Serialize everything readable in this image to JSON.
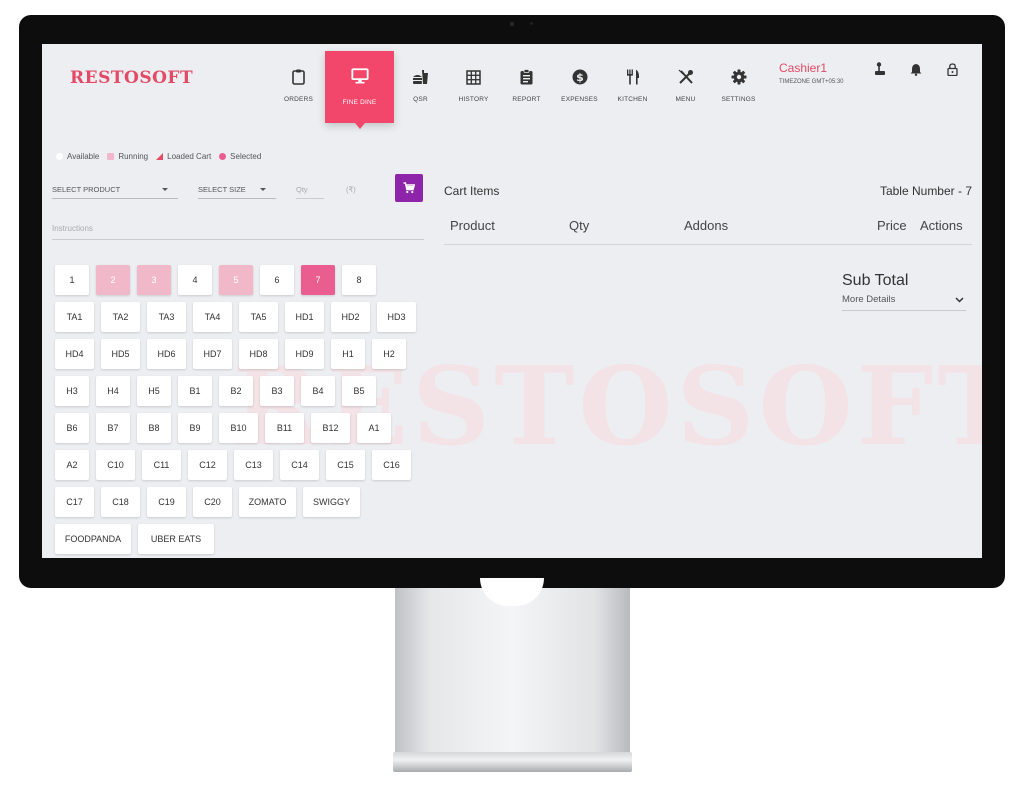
{
  "app": {
    "logo": "RESTOSOFT",
    "watermark": "RESTOSOFT",
    "accent": "#f2466b"
  },
  "nav": [
    {
      "label": "ORDERS",
      "icon": "clipboard-icon",
      "active": false
    },
    {
      "label": "FINE DINE",
      "icon": "monitor-icon",
      "active": true
    },
    {
      "label": "QSR",
      "icon": "fastfood-icon",
      "active": false
    },
    {
      "label": "HISTORY",
      "icon": "grid-icon",
      "active": false
    },
    {
      "label": "REPORT",
      "icon": "report-icon",
      "active": false
    },
    {
      "label": "EXPENSES",
      "icon": "dollar-icon",
      "active": false
    },
    {
      "label": "KITCHEN",
      "icon": "cutlery-icon",
      "active": false
    },
    {
      "label": "MENU",
      "icon": "crossed-utensils-icon",
      "active": false
    },
    {
      "label": "SETTINGS",
      "icon": "gear-icon",
      "active": false
    }
  ],
  "user": {
    "name": "Cashier1",
    "timezone": "TIMEZONE GMT+05:30"
  },
  "legend": [
    {
      "label": "Available",
      "color": "#ffffff"
    },
    {
      "label": "Running",
      "color": "#f0b8c8"
    },
    {
      "label": "Loaded Cart",
      "color": "#e24a66"
    },
    {
      "label": "Selected",
      "color": "#ea5e8f"
    }
  ],
  "form": {
    "select_product": "SELECT PRODUCT",
    "select_size": "SELECT SIZE",
    "qty_placeholder": "Qty",
    "price_placeholder": "(₹)",
    "instructions_placeholder": "Instructions"
  },
  "tables": [
    [
      "1",
      "2",
      "3",
      "4",
      "5",
      "6",
      "7",
      "8"
    ],
    [
      "TA1",
      "TA2",
      "TA3",
      "TA4",
      "TA5",
      "HD1",
      "HD2",
      "HD3"
    ],
    [
      "HD4",
      "HD5",
      "HD6",
      "HD7",
      "HD8",
      "HD9",
      "H1",
      "H2"
    ],
    [
      "H3",
      "H4",
      "H5",
      "B1",
      "B2",
      "B3",
      "B4",
      "B5"
    ],
    [
      "B6",
      "B7",
      "B8",
      "B9",
      "B10",
      "B11",
      "B12",
      "A1"
    ],
    [
      "A2",
      "C10",
      "C11",
      "C12",
      "C13",
      "C14",
      "C15",
      "C16"
    ],
    [
      "C17",
      "C18",
      "C19",
      "C20",
      "ZOMATO",
      "SWIGGY"
    ],
    [
      "FOODPANDA",
      "UBER EATS"
    ]
  ],
  "table_status": {
    "2": "running",
    "3": "running",
    "5": "running",
    "7": "selected"
  },
  "cart": {
    "title": "Cart Items",
    "table_number": "Table Number - 7",
    "columns": [
      "Product",
      "Qty",
      "Addons",
      "Price",
      "Actions"
    ],
    "subtotal_label": "Sub Total",
    "more_details": "More Details"
  }
}
